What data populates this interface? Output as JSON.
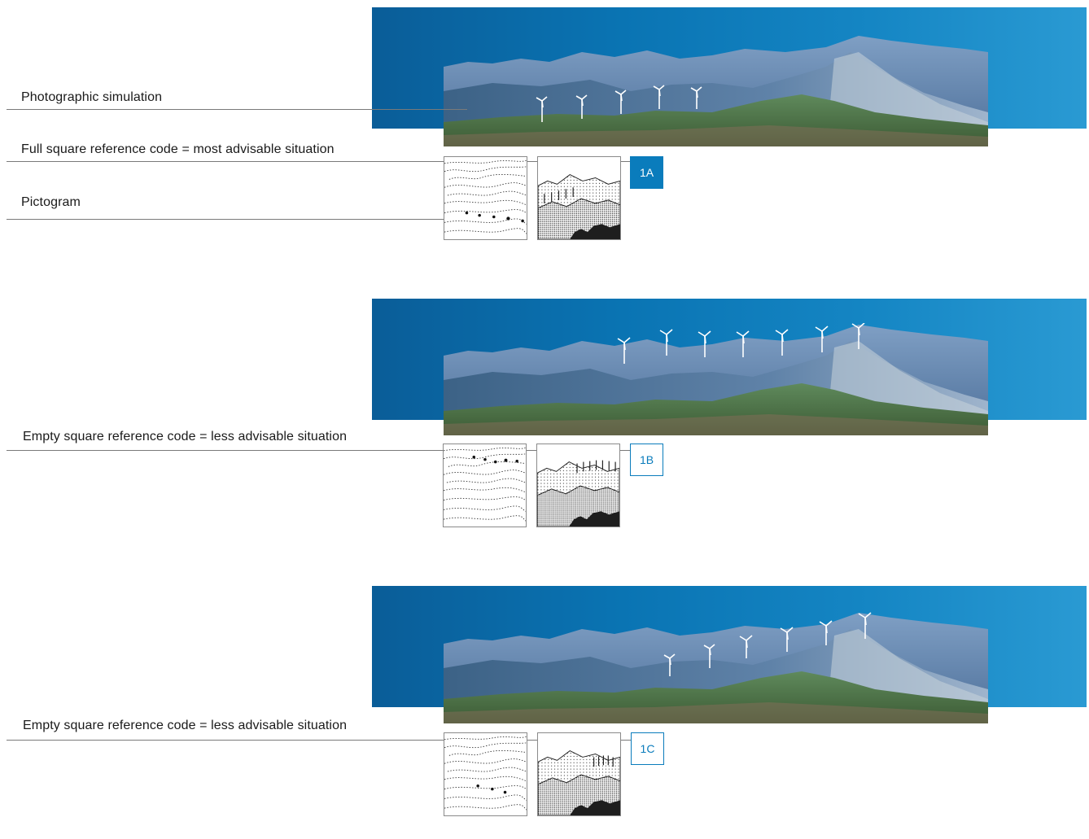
{
  "colors": {
    "accent": "#0a7cbc",
    "sky_dark": "#0a5d98",
    "sky_light": "#2a9ad3"
  },
  "panels": [
    {
      "code": "1A",
      "code_style": "full",
      "labels": {
        "photo": "Photographic simulation",
        "code": "Full square reference code = most advisable situation",
        "pictogram": "Pictogram"
      },
      "turbines": 5
    },
    {
      "code": "1B",
      "code_style": "empty",
      "labels": {
        "code": "Empty square reference code = less advisable situation"
      },
      "turbines": 7
    },
    {
      "code": "1C",
      "code_style": "empty",
      "labels": {
        "code": "Empty square reference code = less advisable situation"
      },
      "turbines": 6
    }
  ]
}
